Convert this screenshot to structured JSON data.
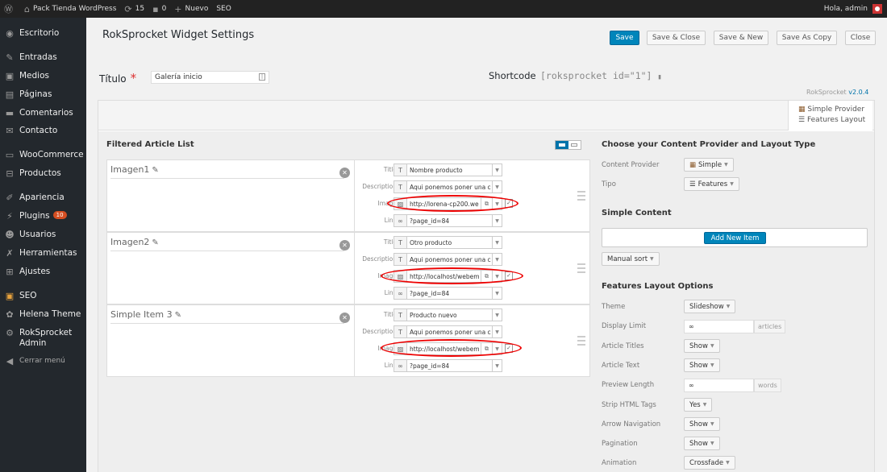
{
  "adminbar": {
    "wp_icon": "wordpress-icon",
    "site_name": "Pack Tienda WordPress",
    "updates_count": "15",
    "comments_count": "0",
    "new_label": "Nuevo",
    "seo_label": "SEO",
    "greeting": "Hola, admin"
  },
  "sidebar": {
    "items": [
      {
        "label": "Escritorio",
        "icon": "dashboard-icon"
      },
      {
        "label": "Entradas",
        "icon": "pin-icon"
      },
      {
        "label": "Medios",
        "icon": "media-icon"
      },
      {
        "label": "Páginas",
        "icon": "pages-icon"
      },
      {
        "label": "Comentarios",
        "icon": "comments-icon"
      },
      {
        "label": "Contacto",
        "icon": "contact-icon"
      },
      {
        "label": "WooCommerce",
        "icon": "woocommerce-icon"
      },
      {
        "label": "Productos",
        "icon": "products-icon"
      },
      {
        "label": "Apariencia",
        "icon": "appearance-icon"
      },
      {
        "label": "Plugins",
        "icon": "plugins-icon",
        "badge": "10"
      },
      {
        "label": "Usuarios",
        "icon": "users-icon"
      },
      {
        "label": "Herramientas",
        "icon": "tools-icon"
      },
      {
        "label": "Ajustes",
        "icon": "settings-icon"
      },
      {
        "label": "SEO",
        "icon": "seo-icon"
      },
      {
        "label": "Helena Theme",
        "icon": "theme-icon"
      },
      {
        "label": "RokSprocket Admin",
        "icon": "roksprocket-icon"
      }
    ],
    "collapse_label": "Cerrar menú"
  },
  "page": {
    "title": "RokSprocket Widget Settings",
    "buttons": {
      "save": "Save",
      "save_close": "Save & Close",
      "save_new": "Save & New",
      "save_copy": "Save As Copy",
      "close": "Close"
    },
    "titulo_label": "Título",
    "titulo_required": "*",
    "titulo_value": "Galería inicio",
    "shortcode_label": "Shortcode",
    "shortcode_value": "[roksprocket id=\"1\"]",
    "version_name": "RokSprocket",
    "version_number": "v2.0.4"
  },
  "provider_tab": {
    "provider": "Simple Provider",
    "layout": "Features Layout"
  },
  "article_list": {
    "heading": "Filtered Article List",
    "field_labels": {
      "title": "Title",
      "description": "Description",
      "image": "Image",
      "link": "Link"
    },
    "items": [
      {
        "name": "Imagen1",
        "title": "Nombre producto",
        "description": "Aqui ponemos poner una c",
        "image": "http://lorena-cp200.we",
        "link": "?page_id=84"
      },
      {
        "name": "Imagen2",
        "title": "Otro producto",
        "description": "Aqui ponemos poner una c",
        "image": "http://localhost/webem",
        "link": "?page_id=84"
      },
      {
        "name": "Simple Item 3",
        "title": "Producto nuevo",
        "description": "Aqui ponemos poner una c",
        "image": "http://localhost/webem",
        "link": "?page_id=84"
      }
    ]
  },
  "right": {
    "provider_heading": "Choose your Content Provider and Layout Type",
    "content_provider_label": "Content Provider",
    "content_provider_value": "Simple",
    "tipo_label": "Tipo",
    "tipo_value": "Features",
    "simple_content_heading": "Simple Content",
    "add_new_item": "Add New Item",
    "sort_value": "Manual sort",
    "features_heading": "Features Layout Options",
    "options": [
      {
        "label": "Theme",
        "value": "Slideshow"
      },
      {
        "label": "Display Limit",
        "value": "∞",
        "addon": "articles"
      },
      {
        "label": "Article Titles",
        "value": "Show"
      },
      {
        "label": "Article Text",
        "value": "Show"
      },
      {
        "label": "Preview Length",
        "value": "∞",
        "addon": "words"
      },
      {
        "label": "Strip HTML Tags",
        "value": "Yes"
      },
      {
        "label": "Arrow Navigation",
        "value": "Show"
      },
      {
        "label": "Pagination",
        "value": "Show"
      },
      {
        "label": "Animation",
        "value": "Crossfade"
      }
    ]
  },
  "colors": {
    "primary": "#0085ba",
    "highlight_oval": "#e00000",
    "sidebar_bg": "#23282d",
    "adminbar_bg": "#222222"
  }
}
